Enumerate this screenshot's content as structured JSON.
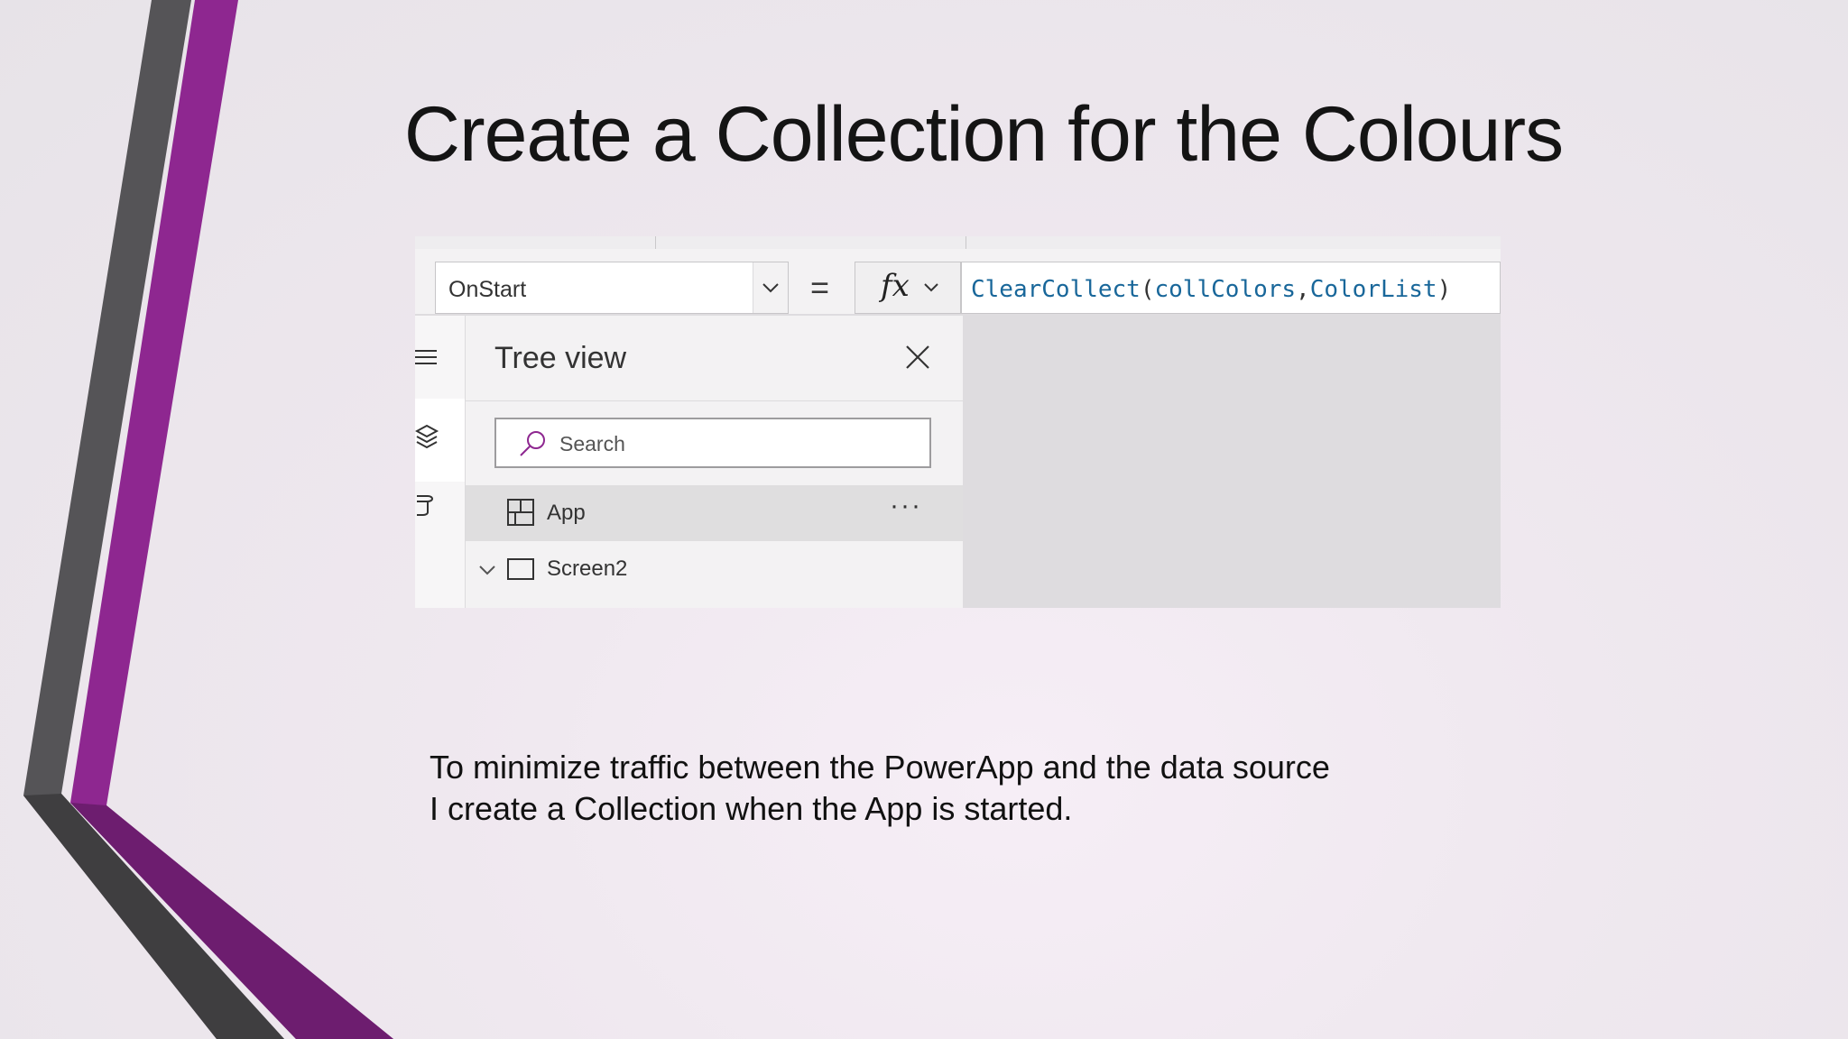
{
  "slide": {
    "title": "Create a Collection for the Colours",
    "body_lines": [
      "To minimize traffic between the PowerApp and the data source",
      "I create a Collection when the App is started."
    ]
  },
  "colors": {
    "accent_purple": "#8e2790",
    "dark_gray": "#3c3c3c",
    "formula_blue": "#19679a"
  },
  "formula_bar": {
    "property": "OnStart",
    "equals": "=",
    "fx_label": "fx",
    "formula_tokens": {
      "fn": "ClearCollect",
      "open": "(",
      "arg1": "collColors",
      "comma": ",",
      "arg2": "ColorList",
      "close": ")"
    }
  },
  "rail": {
    "icons": [
      "hamburger-icon",
      "layers-icon",
      "database-icon"
    ]
  },
  "tree_view": {
    "title": "Tree view",
    "search_placeholder": "Search",
    "items": [
      {
        "label": "App",
        "icon": "app-grid-icon",
        "selected": true,
        "more": "···"
      },
      {
        "label": "Screen2",
        "icon": "screen-icon",
        "expanded": true
      }
    ]
  }
}
